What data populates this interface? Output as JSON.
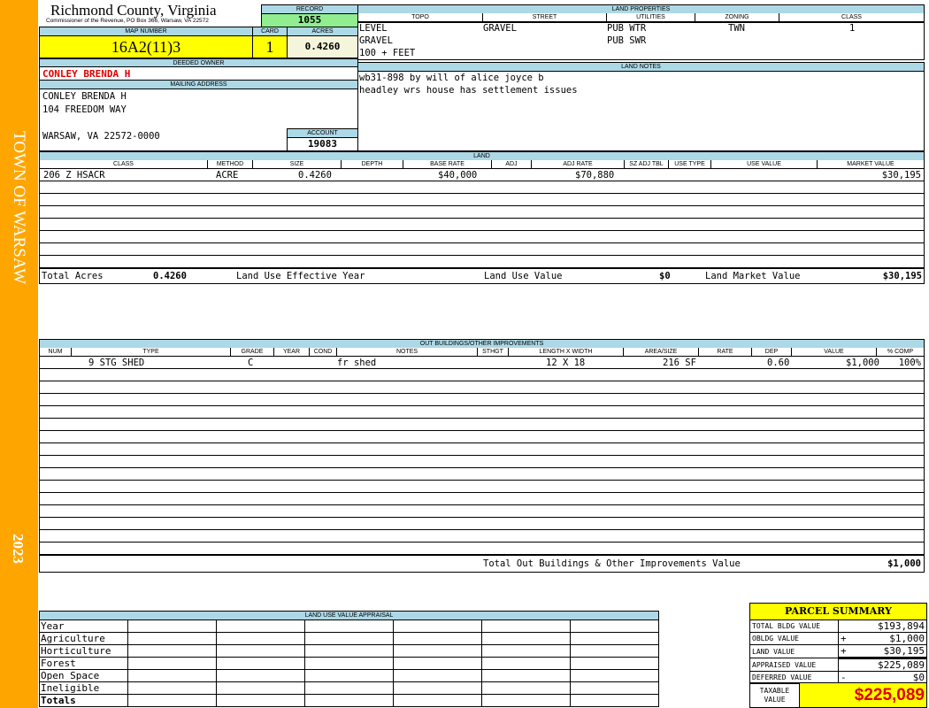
{
  "sidebar": {
    "town": "TOWN OF WARSAW",
    "year": "2023",
    "color": "#ffa500"
  },
  "header": {
    "title": "Richmond County, Virginia",
    "subtitle": "Commissioner of the Revenue, PO Box 366, Warsaw, VA 22572"
  },
  "record": {
    "label": "RECORD",
    "value": "1055"
  },
  "map": {
    "label": "MAP NUMBER",
    "value": "16A2(11)3",
    "card_label": "CARD",
    "card": "1",
    "acres_label": "ACRES",
    "acres": "0.4260"
  },
  "owner": {
    "label": "DEEDED OWNER",
    "value": "CONLEY BRENDA H"
  },
  "mailing": {
    "label": "MAILING ADDRESS",
    "lines": [
      "CONLEY BRENDA H",
      "104 FREEDOM WAY",
      "WARSAW, VA 22572-0000"
    ]
  },
  "account": {
    "label": "ACCOUNT",
    "value": "19083"
  },
  "land_properties": {
    "label": "LAND PROPERTIES",
    "headers": [
      "TOPO",
      "STREET",
      "UTILITIES",
      "ZONING",
      "CLASS"
    ],
    "topo": [
      "LEVEL",
      "GRAVEL",
      "100 + FEET"
    ],
    "street": "GRAVEL",
    "utilities": [
      "PUB WTR",
      "PUB SWR"
    ],
    "zoning": "TWN",
    "class": "1"
  },
  "land_notes": {
    "label": "LAND NOTES",
    "lines": [
      "wb31-898 by will of alice joyce b",
      "headley wrs house has settlement issues"
    ]
  },
  "land": {
    "label": "LAND",
    "headers": [
      "CLASS",
      "METHOD",
      "SIZE",
      "DEPTH",
      "BASE RATE",
      "ADJ",
      "ADJ RATE",
      "SZ ADJ TBL",
      "USE TYPE",
      "USE VALUE",
      "MARKET VALUE"
    ],
    "rows": [
      {
        "class": "206 Z HSACR",
        "method": "ACRE",
        "size": "0.4260",
        "base_rate": "$40,000",
        "adj_rate": "$70,880",
        "market_value": "$30,195"
      }
    ],
    "totals": {
      "acres_label": "Total Acres",
      "acres": "0.4260",
      "effective_year_label": "Land Use Effective Year",
      "use_value_label": "Land Use Value",
      "use_value": "$0",
      "market_label": "Land Market Value",
      "market": "$30,195"
    }
  },
  "outbuildings": {
    "label": "OUT BUILDINGS/OTHER IMPROVEMENTS",
    "headers": [
      "NUM",
      "TYPE",
      "GRADE",
      "YEAR",
      "COND",
      "NOTES",
      "STHGT",
      "LENGTH X WIDTH",
      "AREA/SIZE",
      "RATE",
      "DEP",
      "VALUE",
      "% COMP"
    ],
    "rows": [
      {
        "type": "9 STG SHED",
        "grade": "C",
        "notes": "fr shed",
        "dims": "12 X 18",
        "area": "216 SF",
        "dep": "0.60",
        "value": "$1,000",
        "comp": "100%"
      }
    ],
    "total_label": "Total Out Buildings & Other Improvements Value",
    "total": "$1,000"
  },
  "land_use": {
    "label": "LAND USE VALUE APPRAISAL",
    "rows": [
      "Year",
      "Agriculture",
      "Horticulture",
      "Forest",
      "Open Space",
      "Ineligible",
      "Totals"
    ]
  },
  "parcel_summary": {
    "title": "PARCEL SUMMARY",
    "rows": [
      {
        "label": "TOTAL BLDG VALUE",
        "sign": "",
        "value": "$193,894"
      },
      {
        "label": "OBLDG VALUE",
        "sign": "+",
        "value": "$1,000"
      },
      {
        "label": "LAND VALUE",
        "sign": "+",
        "value": "$30,195"
      },
      {
        "label": "APPRAISED VALUE",
        "sign": "",
        "value": "$225,089"
      },
      {
        "label": "DEFERRED VALUE",
        "sign": "-",
        "value": "$0"
      }
    ],
    "taxable_label": "TAXABLE VALUE",
    "taxable": "$225,089"
  }
}
